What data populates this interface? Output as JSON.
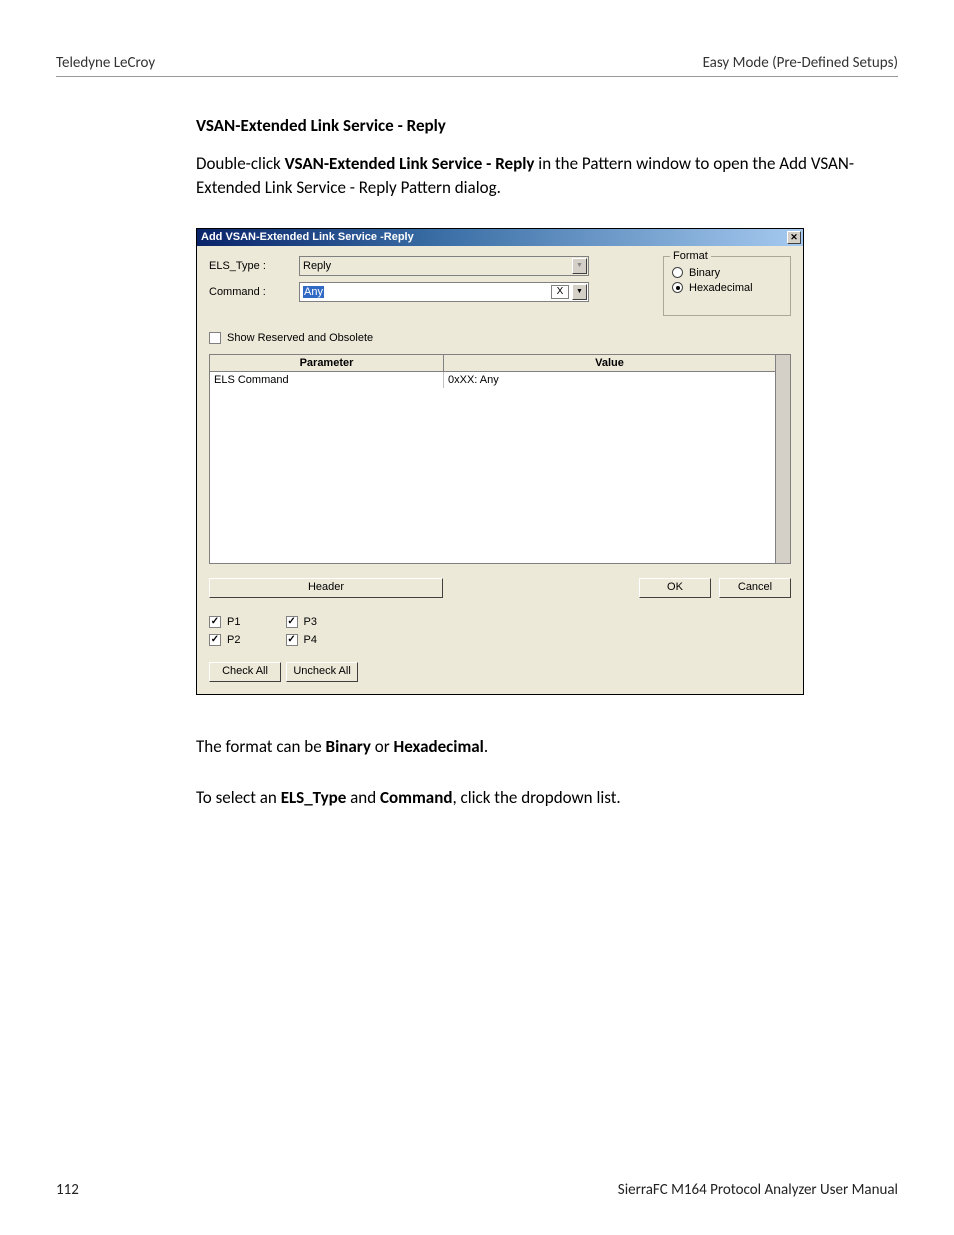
{
  "header": {
    "left": "Teledyne LeCroy",
    "right": "Easy Mode (Pre-Defined Setups)"
  },
  "section_title": "VSAN-Extended Link Service - Reply",
  "para1_pre": "Double-click ",
  "para1_bold": "VSAN-Extended Link Service - Reply",
  "para1_post": " in the Pattern window to open the Add VSAN-Extended Link Service - Reply Pattern dialog.",
  "dialog": {
    "title": "Add VSAN-Extended Link Service -Reply",
    "els_type_label": "ELS_Type :",
    "els_type_value": "Reply",
    "command_label": "Command :",
    "command_value": "Any",
    "x_clear": "X",
    "show_reserved": "Show Reserved and Obsolete",
    "format_legend": "Format",
    "format_binary": "Binary",
    "format_hex": "Hexadecimal",
    "col_parameter": "Parameter",
    "col_value": "Value",
    "row_param": "ELS Command",
    "row_value": "0xXX: Any",
    "header_btn": "Header",
    "ok": "OK",
    "cancel": "Cancel",
    "p1": "P1",
    "p2": "P2",
    "p3": "P3",
    "p4": "P4",
    "check_all": "Check All",
    "uncheck_all": "Uncheck All"
  },
  "para2_pre": "The format can be ",
  "para2_b1": "Binary",
  "para2_mid": " or ",
  "para2_b2": "Hexadecimal",
  "para2_post": ".",
  "para3_pre": "To select an ",
  "para3_b1": "ELS_Type",
  "para3_mid": " and ",
  "para3_b2": "Command",
  "para3_post": ", click the dropdown list.",
  "footer": {
    "page": "112",
    "manual": "SierraFC M164 Protocol Analyzer User Manual"
  }
}
